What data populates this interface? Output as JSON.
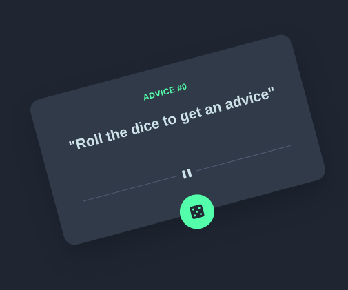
{
  "card": {
    "advice_id": "ADVICE #0",
    "advice_text": "\"Roll the dice to get an advice\""
  },
  "icons": {
    "divider": "pause-divider-icon",
    "dice": "dice-icon"
  },
  "colors": {
    "background": "#1f2632",
    "card": "#313a48",
    "accent": "#53ffaa",
    "text": "#cee3e9",
    "divider": "#4f5d74"
  }
}
